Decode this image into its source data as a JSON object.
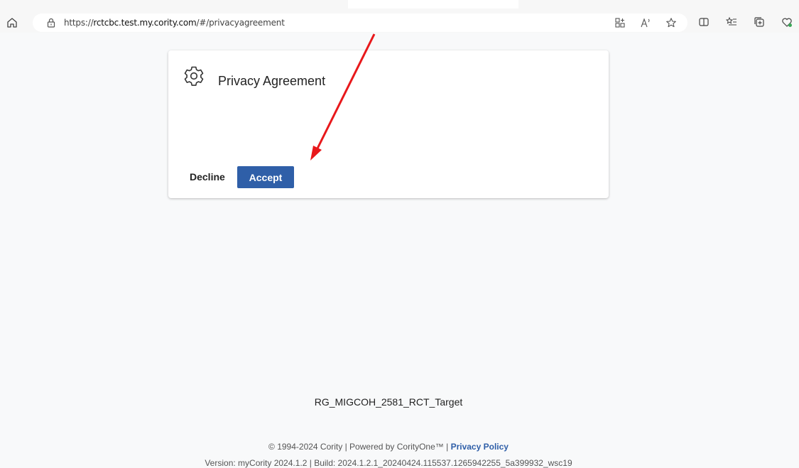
{
  "browser": {
    "url_prefix": "https://",
    "url_host": "rctcbc.test.my.cority.com",
    "url_path": "/#/privacyagreement",
    "icons": [
      "home-icon",
      "lock-icon",
      "apps-icon",
      "read-aloud-icon",
      "favorite-star-icon",
      "split-screen-icon",
      "favorites-list-icon",
      "collections-icon",
      "browser-essentials-icon"
    ]
  },
  "dialog": {
    "title": "Privacy Agreement",
    "icon": "gear-icon",
    "decline_label": "Decline",
    "accept_label": "Accept",
    "accept_color": "#2f5fa8"
  },
  "environment_name": "RG_MIGCOH_2581_RCT_Target",
  "footer": {
    "copyright": "© 1994-2024 Cority | Powered by CorityOne™ |",
    "privacy_link": "Privacy Policy",
    "version": "Version: myCority 2024.1.2 | Build: 2024.1.2.1_20240424.115537.1265942255_5a399932_wsc19"
  },
  "annotation": {
    "arrow_color": "#e8181b"
  }
}
